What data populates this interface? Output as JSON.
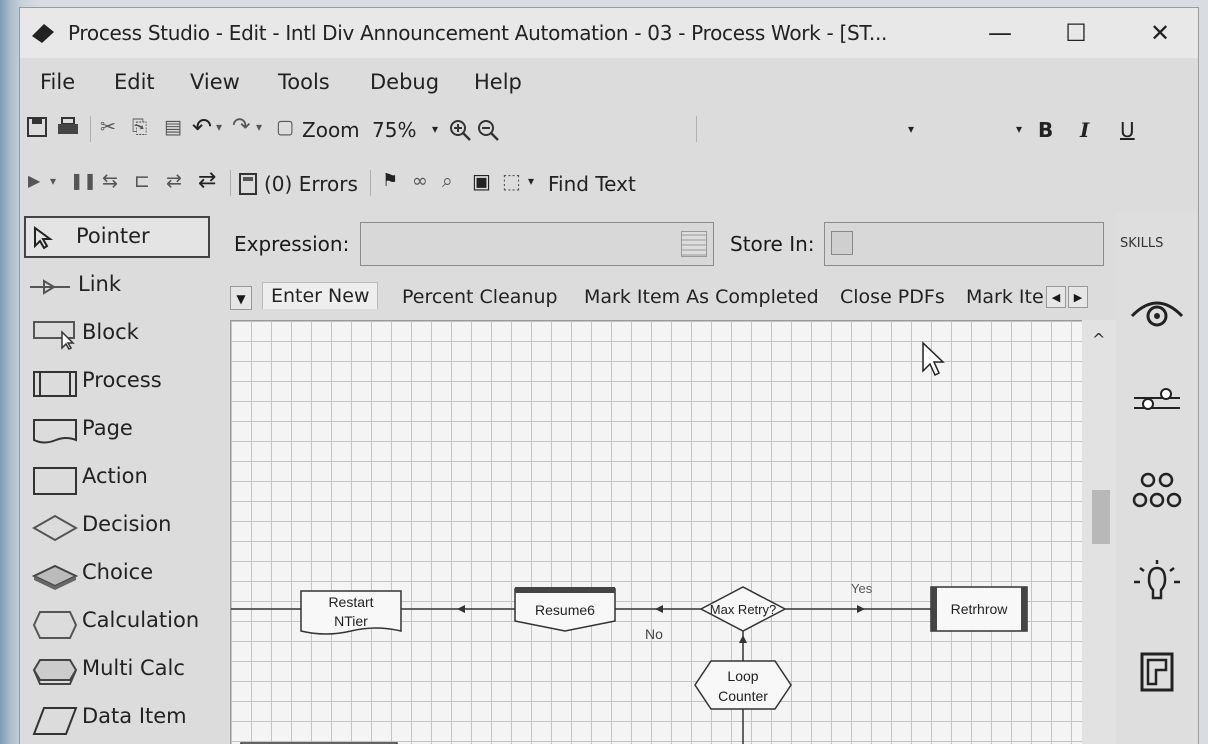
{
  "window": {
    "title": "Process Studio  - Edit - Intl Div Announcement Automation - 03 - Process Work - [ST...",
    "minimize_label": "—",
    "maximize_label": "☐",
    "close_label": "✕"
  },
  "menu": {
    "items": [
      "File",
      "Edit",
      "View",
      "Tools",
      "Debug",
      "Help"
    ]
  },
  "toolbar": {
    "zoom_label": "Zoom",
    "zoom_value": "75%",
    "bold_label": "B",
    "italic_label": "I",
    "underline_label": "U",
    "errors_label": "(0) Errors",
    "find_text_label": "Find Text"
  },
  "stages": [
    {
      "label": "Pointer",
      "icon": "pointer-icon",
      "selected": true
    },
    {
      "label": "Link",
      "icon": "link-icon"
    },
    {
      "label": "Block",
      "icon": "block-icon"
    },
    {
      "label": "Process",
      "icon": "process-icon"
    },
    {
      "label": "Page",
      "icon": "page-icon"
    },
    {
      "label": "Action",
      "icon": "action-icon"
    },
    {
      "label": "Decision",
      "icon": "decision-icon"
    },
    {
      "label": "Choice",
      "icon": "choice-icon"
    },
    {
      "label": "Calculation",
      "icon": "calculation-icon"
    },
    {
      "label": "Multi Calc",
      "icon": "multi-calc-icon"
    },
    {
      "label": "Data Item",
      "icon": "data-item-icon"
    }
  ],
  "expression": {
    "label": "Expression:",
    "value": ""
  },
  "store_in": {
    "label": "Store In:",
    "value": ""
  },
  "tabs": [
    "Enter New",
    "Percent Cleanup",
    "Mark Item As Completed",
    "Close PDFs",
    "Mark Ite"
  ],
  "skills": {
    "header": "SKILLS",
    "icons": [
      "eye-icon",
      "sliders-icon",
      "people-group-icon",
      "lightbulb-icon",
      "logo-icon"
    ]
  },
  "diagram": {
    "nodes": {
      "restart_line1": "Restart",
      "restart_line2": "NTier",
      "resume": "Resume6",
      "decision": "Max Retry?",
      "loop_line1": "Loop",
      "loop_line2": "Counter",
      "rethrow": "Retrhrow"
    },
    "labels": {
      "yes": "Yes",
      "no": "No"
    }
  }
}
